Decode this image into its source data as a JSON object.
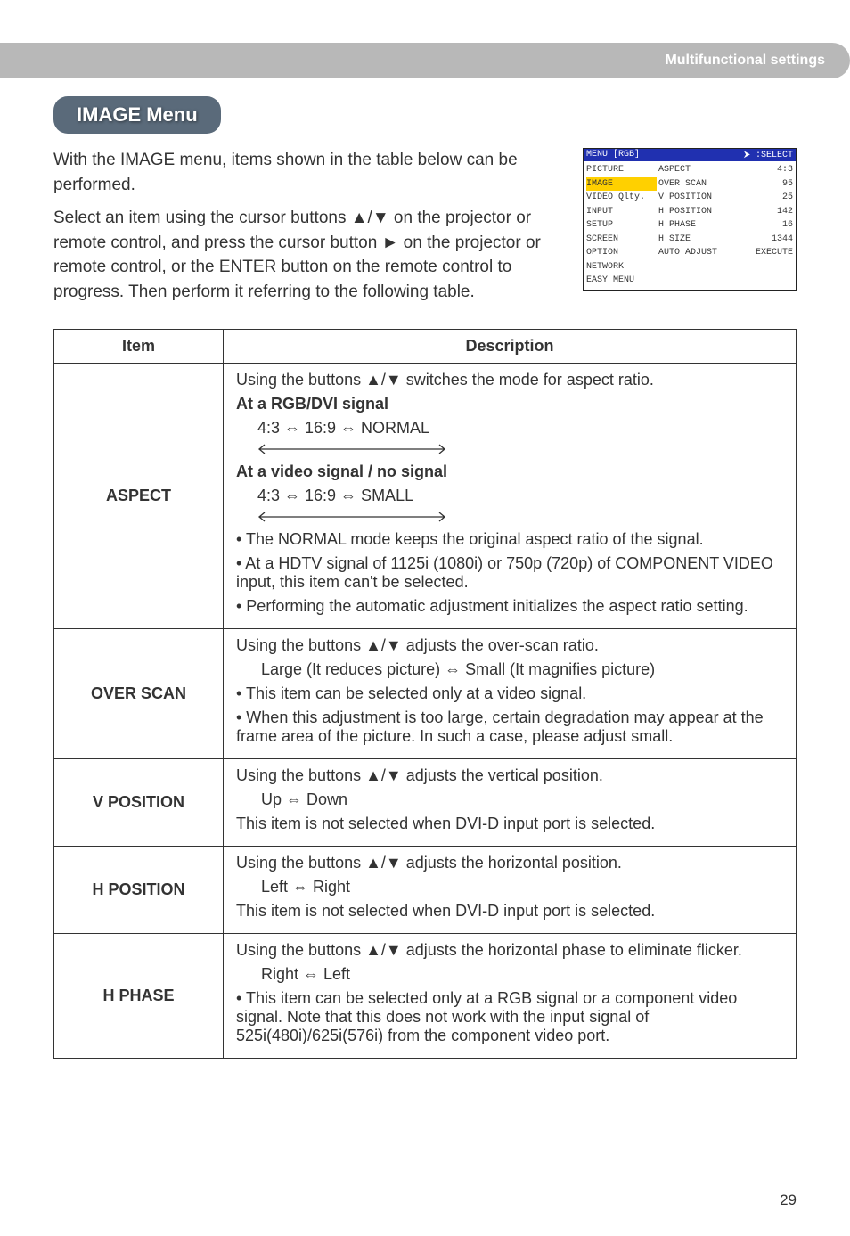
{
  "header_band": "Multifunctional settings",
  "menu_title": "IMAGE Menu",
  "intro1": "With the IMAGE menu, items shown in the table below can be performed.",
  "intro2": "Select an item using the cursor buttons ▲/▼ on the projector or remote control, and press the cursor button ► on the projector or remote control, or the ENTER button on the remote control to progress. Then perform it referring to the following table.",
  "osd": {
    "title_left": "MENU [RGB]",
    "title_right": "⮞ :SELECT",
    "left": [
      "PICTURE",
      "IMAGE",
      "VIDEO Qlty.",
      "INPUT",
      "SETUP",
      "SCREEN",
      "OPTION",
      "NETWORK",
      "EASY MENU"
    ],
    "right": [
      [
        "ASPECT",
        "4:3"
      ],
      [
        "OVER SCAN",
        "95"
      ],
      [
        "V POSITION",
        "25"
      ],
      [
        "H POSITION",
        "142"
      ],
      [
        "H PHASE",
        "16"
      ],
      [
        "H SIZE",
        "1344"
      ],
      [
        "AUTO ADJUST",
        "EXECUTE"
      ]
    ]
  },
  "table": {
    "h_item": "Item",
    "h_desc": "Description",
    "aspect": {
      "label": "ASPECT",
      "line1": "Using the buttons ▲/▼ switches the mode for aspect ratio.",
      "sig1_title": "At a RGB/DVI signal",
      "sig1_opts": "4:3 ⇔ 16:9 ⇔ NORMAL",
      "sig2_title": "At a video signal / no signal",
      "sig2_opts": "4:3 ⇔ 16:9 ⇔ SMALL",
      "b1": "• The NORMAL mode keeps the original aspect ratio of the signal.",
      "b2": "• At a HDTV signal of 1125i (1080i) or 750p (720p) of COMPONENT VIDEO input, this item can't be selected.",
      "b3": "• Performing the automatic adjustment initializes the aspect ratio setting."
    },
    "overscan": {
      "label": "OVER SCAN",
      "line1": "Using the buttons ▲/▼ adjusts the over-scan ratio.",
      "line2": "Large (It reduces picture) ⇔ Small (It magnifies picture)",
      "b1": "• This item can be selected only at a video signal.",
      "b2": "• When this adjustment is too large, certain degradation may appear at the frame area of the picture. In such a case, please adjust small."
    },
    "vpos": {
      "label": "V POSITION",
      "line1": "Using the buttons ▲/▼ adjusts the vertical position.",
      "line2": "Up ⇔ Down",
      "line3": "This item is not selected when DVI-D input port is selected."
    },
    "hpos": {
      "label": "H POSITION",
      "line1": "Using the buttons ▲/▼ adjusts the horizontal position.",
      "line2": "Left ⇔ Right",
      "line3": "This item is not selected when DVI-D input port is selected."
    },
    "hphase": {
      "label": "H PHASE",
      "line1": "Using the buttons ▲/▼ adjusts the horizontal phase to eliminate flicker.",
      "line2": "Right ⇔ Left",
      "b1": "• This item can be selected only at a RGB signal or a component video signal. Note that this does not work with the input signal of 525i(480i)/625i(576i) from the component video port."
    }
  },
  "pagenum": "29"
}
